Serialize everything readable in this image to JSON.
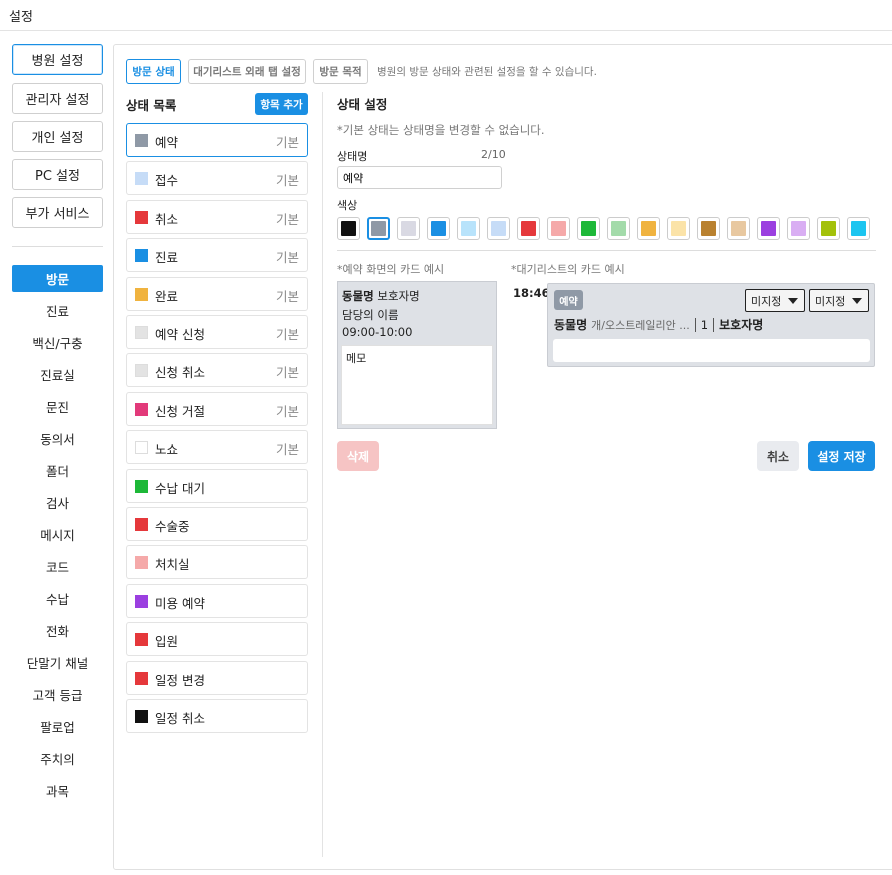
{
  "window": {
    "title": "설정"
  },
  "left_nav": {
    "items": [
      "병원 설정",
      "관리자 설정",
      "개인 설정",
      "PC 설정",
      "부가 서비스"
    ],
    "sub_items": [
      "방문",
      "진료",
      "백신/구충",
      "진료실",
      "문진",
      "동의서",
      "폴더",
      "검사",
      "메시지",
      "코드",
      "수납",
      "전화",
      "단말기 채널",
      "고객 등급",
      "팔로업",
      "주치의",
      "과목"
    ]
  },
  "tabs": [
    "방문 상태",
    "대기리스트 외래 탭 설정",
    "방문 목적"
  ],
  "tab_description": "병원의 방문 상태와 관련된 설정을 할 수 있습니다.",
  "status_list": {
    "title": "상태 목록",
    "add_button": "항목 추가",
    "items": [
      {
        "label": "예약",
        "basic": "기본",
        "color": "#8f99a6"
      },
      {
        "label": "접수",
        "basic": "기본",
        "color": "#c6dcf7"
      },
      {
        "label": "취소",
        "basic": "기본",
        "color": "#e5383b"
      },
      {
        "label": "진료",
        "basic": "기본",
        "color": "#1a8fe3"
      },
      {
        "label": "완료",
        "basic": "기본",
        "color": "#f0b33f"
      },
      {
        "label": "예약 신청",
        "basic": "기본",
        "color": "#e3e3e3"
      },
      {
        "label": "신청 취소",
        "basic": "기본",
        "color": "#e3e3e3"
      },
      {
        "label": "신청 거절",
        "basic": "기본",
        "color": "#e23a7a"
      },
      {
        "label": "노쇼",
        "basic": "기본",
        "color": "#ffffff"
      },
      {
        "label": "수납 대기",
        "basic": "",
        "color": "#1db838"
      },
      {
        "label": "수술중",
        "basic": "",
        "color": "#e5383b"
      },
      {
        "label": "처치실",
        "basic": "",
        "color": "#f5a9a9"
      },
      {
        "label": "미용 예약",
        "basic": "",
        "color": "#9b3fe0"
      },
      {
        "label": "입원",
        "basic": "",
        "color": "#e5383b"
      },
      {
        "label": "일정 변경",
        "basic": "",
        "color": "#e5383b"
      },
      {
        "label": "일정 취소",
        "basic": "",
        "color": "#111111"
      }
    ]
  },
  "settings": {
    "title": "상태 설정",
    "note": "*기본 상태는 상태명을 변경할 수 없습니다.",
    "name_label": "상태명",
    "name_count": "2/10",
    "name_value": "예약",
    "color_label": "색상",
    "colors": [
      "#111111",
      "#8f99a6",
      "#d9d9e3",
      "#1a8fe3",
      "#b8e3fb",
      "#c6dcf7",
      "#e5383b",
      "#f5a9a9",
      "#1db838",
      "#a3dbaa",
      "#f0b33f",
      "#fbe3a8",
      "#b9812f",
      "#e8c8a0",
      "#9b3fe0",
      "#d9aef3",
      "#a3c10a",
      "#1cc5f0"
    ],
    "selected_color_index": 1
  },
  "examples": {
    "reservation_label": "*예약 화면의 카드 예시",
    "reservation_card": {
      "animal": "동물명",
      "guardian": "보호자명",
      "staff": "담당의 이름",
      "time": "09:00-10:00",
      "memo": "메모"
    },
    "waitlist_label": "*대기리스트의 카드 예시",
    "waitlist_card": {
      "time": "18:46",
      "badge": "예약",
      "dropdown1": "미지정",
      "dropdown2": "미지정",
      "animal": "동물명",
      "species": "개/오스트레일리안 ...",
      "count": "1",
      "guardian": "보호자명"
    }
  },
  "buttons": {
    "delete": "삭제",
    "cancel": "취소",
    "save": "설정 저장"
  }
}
